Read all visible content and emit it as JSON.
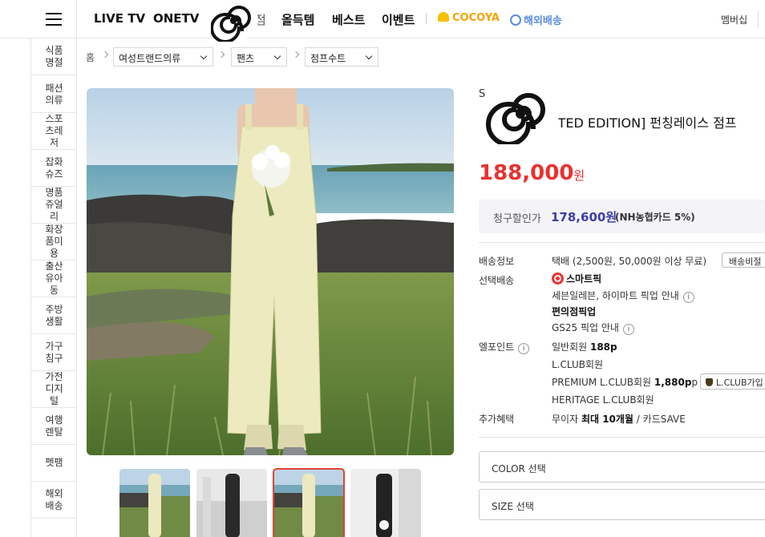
{
  "header": {
    "nav": [
      "LIVE TV",
      "ONETV",
      "점",
      "올득템",
      "베스트",
      "이벤트"
    ],
    "cocoya": "COCOYA",
    "global": "해외배송",
    "membership": "멤버십"
  },
  "sidebar": {
    "categories": [
      "식품명절",
      "패션의류",
      "스포츠레저",
      "잡화슈즈",
      "명품쥬얼리",
      "화장품미용",
      "출산유아동",
      "주방생활",
      "가구침구",
      "가전디지털",
      "여행렌탈",
      "펫팸",
      "해외배송"
    ]
  },
  "breadcrumb": {
    "home": "홈",
    "items": [
      "여성트랜드의류",
      "팬츠",
      "점프수트"
    ]
  },
  "product": {
    "brand_initial": "S",
    "title": "[LIMITED EDITION] 펀칭레이스 점프",
    "title_visible": "LYTED EDITION] 펀칭레이스 점프",
    "price": "188,000",
    "price_unit": "원",
    "discount_label": "청구할인가",
    "discount_price": "178,600원",
    "discount_card": "(NH농협카드 5%)"
  },
  "details": {
    "shipping_label": "배송정보",
    "shipping_value": "택배 (2,500원, 50,000원 이상 무료)",
    "shipping_button": "배송비절",
    "select_shipping_label": "선택배송",
    "smart_pick": "스마트픽",
    "smart_pick_desc": "세븐일레븐, 하이마트 픽업 안내",
    "convenience_pick": "편의점픽업",
    "gs25": "GS25 픽업 안내",
    "point_label": "엘포인트",
    "point_general_pre": "일반회원 ",
    "point_general_val": "188p",
    "point_lclub": "L.CLUB회원",
    "point_premium_pre": "PREMIUM L.CLUB회원 ",
    "point_premium_val": "1,880p",
    "lclub_button": "L.CLUB가입",
    "point_heritage": "HERITAGE L.CLUB회원",
    "benefit_label": "추가혜택",
    "benefit_pre": "무이자 ",
    "benefit_bold": "최대 10개월",
    "benefit_post": " / 카드SAVE"
  },
  "options": {
    "color": "COLOR 선택",
    "size": "SIZE 선택"
  }
}
